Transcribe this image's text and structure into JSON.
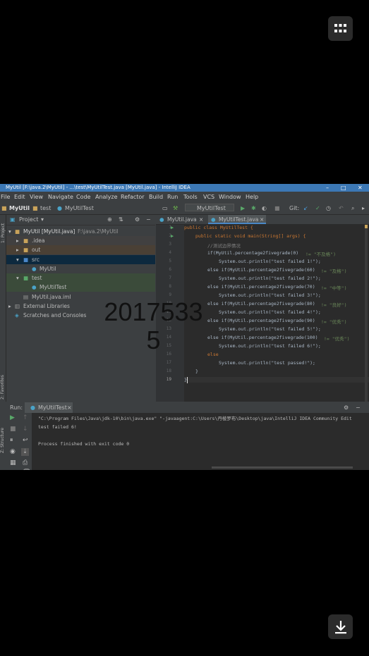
{
  "window": {
    "title": "MyUtil [F:\\java.2\\MyUtil] - ...\\test\\MyUtilTest.java [MyUtil.java] - IntelliJ IDEA"
  },
  "menu": [
    "File",
    "Edit",
    "View",
    "Navigate",
    "Code",
    "Analyze",
    "Refactor",
    "Build",
    "Run",
    "Tools",
    "VCS",
    "Window",
    "Help"
  ],
  "nav": {
    "crumb1": "MyUtil",
    "crumb2": "test",
    "crumb3": "MyUtilTest",
    "run_config": "MyUtilTest",
    "git_label": "Git:"
  },
  "side_labels": {
    "project": "1: Project",
    "favorites": "2: Favorites",
    "structure": "Z: Structure"
  },
  "project": {
    "header": "Project",
    "tree": [
      {
        "label": "MyUtil [MyUtil.java]",
        "path": "F:\\java.2\\MyUtil"
      },
      {
        "label": ".idea"
      },
      {
        "label": "out"
      },
      {
        "label": "src"
      },
      {
        "label": "MyUtil"
      },
      {
        "label": "test"
      },
      {
        "label": "MyUtilTest"
      },
      {
        "label": "MyUtil.java.iml"
      },
      {
        "label": "External Libraries"
      },
      {
        "label": "Scratches and Consoles"
      }
    ]
  },
  "editor": {
    "tabs": [
      "MyUtil.java",
      "MyUtilTest.java"
    ],
    "line_numbers": [
      "1",
      "2",
      "3",
      "4",
      "5",
      "6",
      "7",
      "8",
      "9",
      "10",
      "11",
      "12",
      "13",
      "14",
      "15",
      "16",
      "17",
      "18",
      "19"
    ],
    "lines": {
      "l1": "public class MyUtilTest {",
      "l2": "public static void main(String[] args) {",
      "l3": "//测试边界情况",
      "l4a": "if(MyUtil.percentage2fivegrade(0)",
      "l4b": "!= \"不及格\")",
      "l5": "System.out.println(\"test failed 1!\");",
      "l6a": "else if(MyUtil.percentage2fivegrade(60)",
      "l6b": "!= \"及格\")",
      "l7": "System.out.println(\"test failed 2!\");",
      "l8a": "else if(MyUtil.percentage2fivegrade(70)",
      "l8b": "!= \"中等\")",
      "l9": "System.out.println(\"test failed 3!\");",
      "l10a": "else if(MyUtil.percentage2fivegrade(80)",
      "l10b": "!= \"良好\")",
      "l11": "System.out.println(\"test failed 4!\");",
      "l12a": "else if(MyUtil.percentage2fivegrade(90)",
      "l12b": "!= \"优秀\")",
      "l13": "System.out.println(\"test failed 5!\");",
      "l14a": "else if(MyUtil.percentage2fivegrade(100)",
      "l14b": "!= \"优秀\")",
      "l15": "System.out.println(\"test failed 6!\");",
      "l16": "else",
      "l17": "System.out.println(\"test passed!\");",
      "l18": "}",
      "l19": "}"
    }
  },
  "run": {
    "label": "Run:",
    "tab": "MyUtilTest",
    "cmd": "\"C:\\Program Files\\Java\\jdk-10\\bin\\java.exe\" \"-javaagent:C:\\Users\\丹棱罗布\\Desktop\\java\\IntelliJ IDEA Community Edit",
    "out1": "test failed 6!",
    "out2": "Process finished with exit code 0"
  },
  "watermark": {
    "line1": "2017533",
    "line2": "5"
  },
  "icons": {
    "grid": "grid-menu-icon",
    "download": "download-icon"
  },
  "colors": {
    "title_bar": "#3c78b5",
    "ide_bg": "#3c3f41",
    "editor_bg": "#2b2b2b",
    "keyword": "#cc7832",
    "string": "#6a8759"
  }
}
